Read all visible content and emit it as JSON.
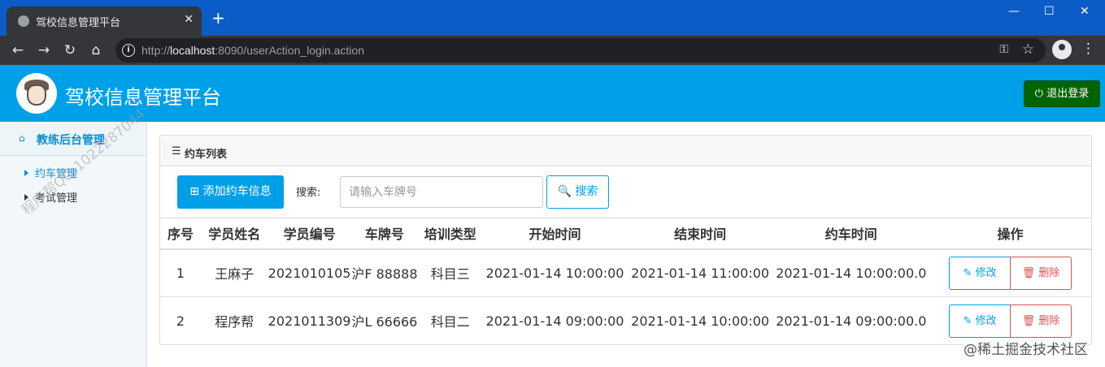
{
  "browser": {
    "tab_title": "驾校信息管理平台",
    "tab_close": "✕",
    "new_tab": "+",
    "win_min": "—",
    "win_max": "☐",
    "win_close": "✕",
    "back": "←",
    "forward": "→",
    "reload": "↻",
    "home": "⌂",
    "url_prefix": "http://",
    "url_host": "localhost",
    "url_rest": ":8090/userAction_login.action",
    "key_icon": "⚿",
    "star_icon": "☆",
    "menu_icon": "⋮"
  },
  "header": {
    "title": "驾校信息管理平台",
    "logout_label": "⏻ 退出登录"
  },
  "sidebar": {
    "section_icon": "⌂",
    "section_label": "教练后台管理",
    "items": [
      {
        "label": "约车管理"
      },
      {
        "label": "考试管理"
      }
    ],
    "watermark": "程序帮QQ:1022287044"
  },
  "panel": {
    "title_icon": "☰",
    "title": "约车列表",
    "add_button": "⊞ 添加约车信息",
    "search_label": "搜索:",
    "search_placeholder": "请输入车牌号",
    "search_button": "🔍 搜索"
  },
  "table": {
    "headers": [
      "序号",
      "学员姓名",
      "学员编号",
      "车牌号",
      "培训类型",
      "开始时间",
      "结束时间",
      "约车时间",
      "操作"
    ],
    "rows": [
      [
        "1",
        "王麻子",
        "2021010105",
        "沪F 88888",
        "科目三",
        "2021-01-14 10:00:00",
        "2021-01-14 11:00:00",
        "2021-01-14 10:00:00.0"
      ],
      [
        "2",
        "程序帮",
        "2021011309",
        "沪L 66666",
        "科目二",
        "2021-01-14 09:00:00",
        "2021-01-14 10:00:00",
        "2021-01-14 09:00:00.0"
      ]
    ],
    "edit_label": "✎ 修改",
    "delete_label": "🗑 删除"
  },
  "footer": {
    "mark": "@稀土掘金技术社区"
  }
}
